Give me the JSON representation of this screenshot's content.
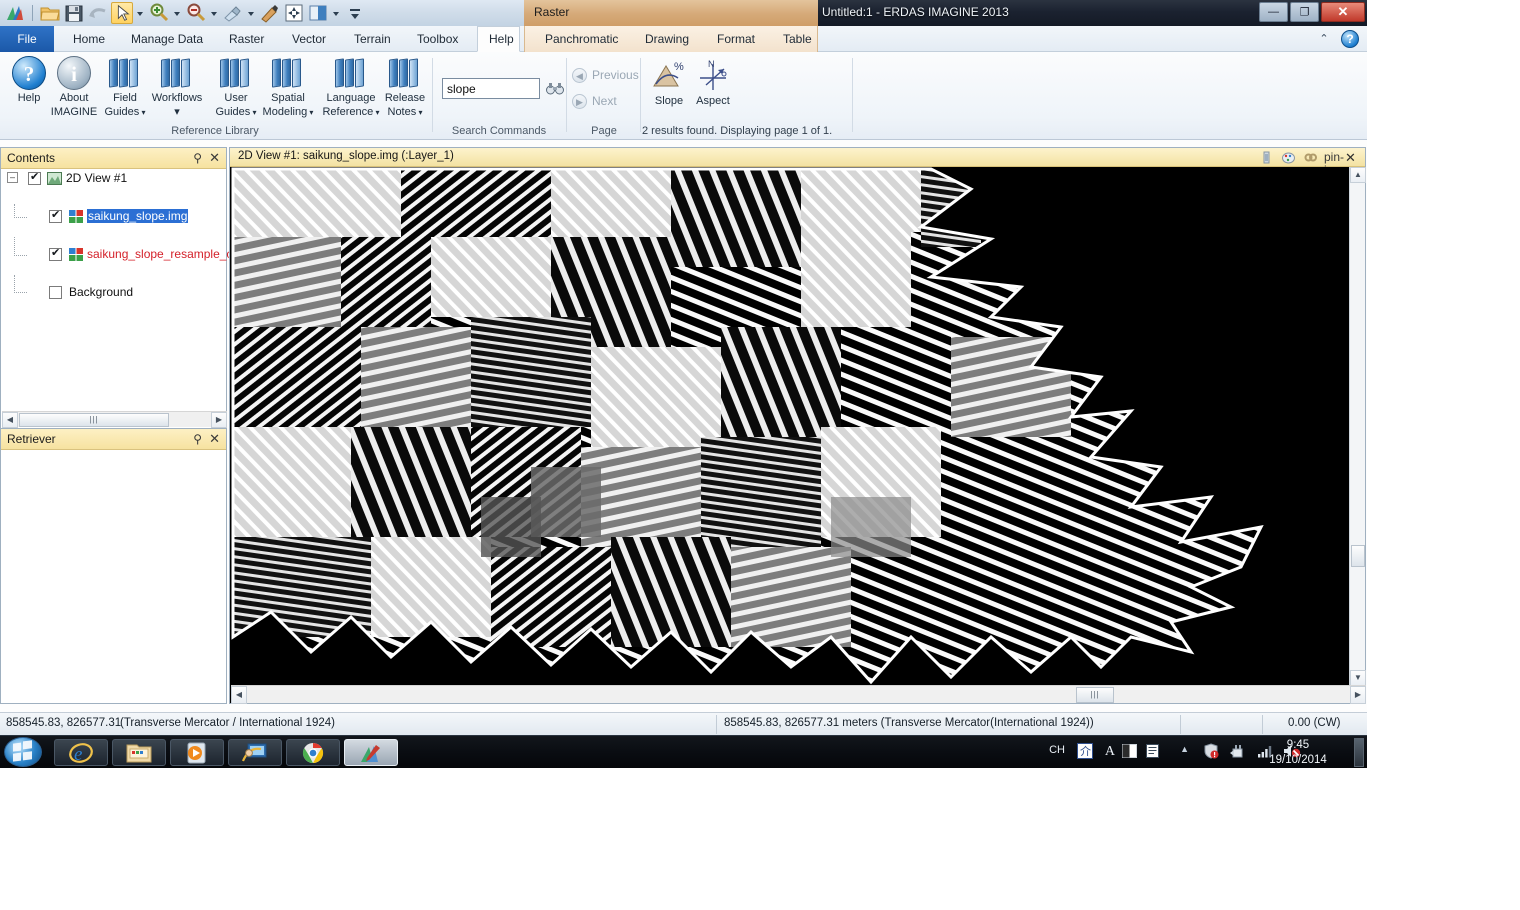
{
  "window": {
    "title": "Untitled:1 - ERDAS IMAGINE 2013",
    "contextual_group": "Raster",
    "minimize": "—",
    "restore": "❐",
    "close": "✕"
  },
  "quick_access": {
    "items": [
      {
        "name": "erdas-logo-icon",
        "label": "ERDAS IMAGINE"
      },
      {
        "name": "open-file-icon",
        "label": "Open"
      },
      {
        "name": "save-icon",
        "label": "Save"
      },
      {
        "name": "undo-icon",
        "label": "Undo"
      },
      {
        "name": "select-tool-icon",
        "label": "Select"
      },
      {
        "name": "zoom-in-icon",
        "label": "Zoom In"
      },
      {
        "name": "zoom-out-icon",
        "label": "Zoom Out"
      },
      {
        "name": "pan-icon",
        "label": "Pan"
      },
      {
        "name": "inquire-cursor-icon",
        "label": "Inquire"
      },
      {
        "name": "fit-to-frame-icon",
        "label": "Fit to Frame"
      },
      {
        "name": "swipe-icon",
        "label": "Swipe"
      },
      {
        "name": "qat-overflow-icon",
        "label": "More"
      }
    ]
  },
  "tabs": {
    "main": [
      "File",
      "Home",
      "Manage Data",
      "Raster",
      "Vector",
      "Terrain",
      "Toolbox",
      "Help"
    ],
    "active": "Help",
    "contextual": [
      "Panchromatic",
      "Drawing",
      "Format",
      "Table"
    ]
  },
  "ribbon": {
    "collapse_icon": "⌃",
    "help_icon": "?",
    "reference_library": {
      "title": "Reference Library",
      "buttons": [
        {
          "line1": "Help",
          "line2": "",
          "caret": false,
          "icon": "help-circle-icon"
        },
        {
          "line1": "About",
          "line2": "IMAGINE",
          "caret": false,
          "icon": "info-circle-icon"
        },
        {
          "line1": "Field",
          "line2": "Guides",
          "caret": true,
          "icon": "books-icon"
        },
        {
          "line1": "Workflows",
          "line2": "",
          "caret": true,
          "icon": "books-icon"
        },
        {
          "line1": "User",
          "line2": "Guides",
          "caret": true,
          "icon": "books-icon"
        },
        {
          "line1": "Spatial",
          "line2": "Modeling",
          "caret": true,
          "icon": "books-icon"
        },
        {
          "line1": "Language",
          "line2": "Reference",
          "caret": true,
          "icon": "books-icon"
        },
        {
          "line1": "Release",
          "line2": "Notes",
          "caret": true,
          "icon": "books-icon"
        }
      ]
    },
    "search_commands": {
      "title": "Search Commands",
      "query": "slope",
      "placeholder": "",
      "search_icon": "binoculars-icon"
    },
    "page": {
      "title": "Page",
      "previous": "Previous",
      "next": "Next"
    },
    "results": {
      "items": [
        {
          "label": "Slope",
          "icon": "slope-icon"
        },
        {
          "label": "Aspect",
          "icon": "aspect-icon"
        }
      ],
      "note": "2 results found.  Displaying page 1 of 1."
    }
  },
  "contents_panel": {
    "title": "Contents",
    "pin_icon": "⚲",
    "close_icon": "✕",
    "tree": [
      {
        "label": "2D View #1",
        "checked": true,
        "indent": 0,
        "icon": "view-icon",
        "style": "normal"
      },
      {
        "label": "saikung_slope.img",
        "checked": true,
        "indent": 1,
        "icon": "raster-layer-icon",
        "style": "selected"
      },
      {
        "label": "saikung_slope_resample_c",
        "checked": true,
        "indent": 1,
        "icon": "raster-layer-icon",
        "style": "red"
      },
      {
        "label": "Background",
        "checked": false,
        "indent": 1,
        "icon": "",
        "style": "normal"
      }
    ]
  },
  "retriever_panel": {
    "title": "Retriever",
    "pin_icon": "⚲",
    "close_icon": "✕"
  },
  "view_window": {
    "title": "2D View #1: saikung_slope.img (:Layer_1)",
    "header_icons": [
      "thumbnail-icon",
      "palette-icon",
      "link-icon",
      "pin-icon",
      "close-icon"
    ]
  },
  "status_bar": {
    "coords": "858545.83, 826577.31",
    "projection": "(Transverse Mercator / International 1924)",
    "meters": "858545.83, 826577.31 meters (Transverse Mercator(International 1924))",
    "rotation": "0.00 (CW)"
  },
  "taskbar": {
    "start_icon": "windows-start-icon",
    "buttons": [
      {
        "name": "internet-explorer-icon",
        "label": "Internet Explorer",
        "active": false
      },
      {
        "name": "file-explorer-icon",
        "label": "Windows Explorer",
        "active": false
      },
      {
        "name": "media-player-icon",
        "label": "Windows Media Player",
        "active": false
      },
      {
        "name": "remote-desktop-icon",
        "label": "Remote Desktop",
        "active": false
      },
      {
        "name": "chrome-icon",
        "label": "Google Chrome",
        "active": false
      },
      {
        "name": "erdas-imagine-icon",
        "label": "ERDAS IMAGINE 2013",
        "active": true
      }
    ],
    "tray": {
      "ime_language": "CH",
      "ime_mode_icon": "ime-chinese-icon",
      "ime_letter": "A",
      "ime_halfwidth_icon": "halfwidth-icon",
      "ime_toolbar_icon": "ime-toolbar-icon",
      "overflow_icon": "▲",
      "security_icon": "action-center-icon",
      "usb_icon": "safely-remove-icon",
      "network_icon": "network-signal-icon",
      "volume_icon": "volume-muted-icon"
    },
    "clock": {
      "time": "9:45",
      "date": "19/10/2014"
    }
  },
  "colors": {
    "file_tab": "#1b58a8",
    "contextual": "#d5a978",
    "panel_header": "#f6e2a0",
    "selection": "#2b6fd4",
    "layer_red": "#d4212a"
  }
}
